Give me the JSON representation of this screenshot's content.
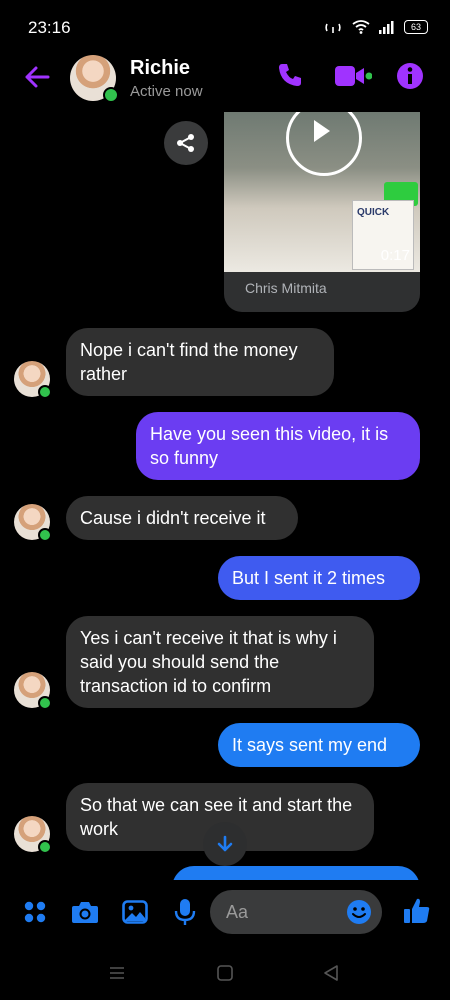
{
  "status_bar": {
    "time": "23:16",
    "battery": "63"
  },
  "header": {
    "contact_name": "Richie",
    "contact_status": "Active now"
  },
  "shared_video": {
    "duration": "0:17",
    "caption": "Chris Mitmita",
    "box_label": "QUICK"
  },
  "messages": [
    {
      "side": "received",
      "text": "Nope i can't find the money rather"
    },
    {
      "side": "sent",
      "text": "Have you seen this video, it is so funny"
    },
    {
      "side": "received",
      "text": "Cause i didn't receive it"
    },
    {
      "side": "sent",
      "text": "But I sent it 2 times"
    },
    {
      "side": "received",
      "text": "Yes i can't receive it that is why i said you should send the transaction id to confirm"
    },
    {
      "side": "sent",
      "text": "It says sent my end"
    },
    {
      "side": "received",
      "text": "So that we can see it and start the work"
    }
  ],
  "composer": {
    "placeholder": "Aa"
  },
  "colors": {
    "accent": "#a033ff",
    "sent_purple": "#6b3df2",
    "sent_blue": "#1f7cf2",
    "received": "#303030",
    "online": "#31c24d",
    "send_like": "#1f7cf2"
  },
  "icons": [
    "back-arrow-icon",
    "phone-icon",
    "video-call-icon",
    "info-icon",
    "share-icon",
    "play-icon",
    "scroll-down-icon",
    "apps-icon",
    "camera-icon",
    "gallery-icon",
    "microphone-icon",
    "emoji-icon",
    "like-icon"
  ]
}
